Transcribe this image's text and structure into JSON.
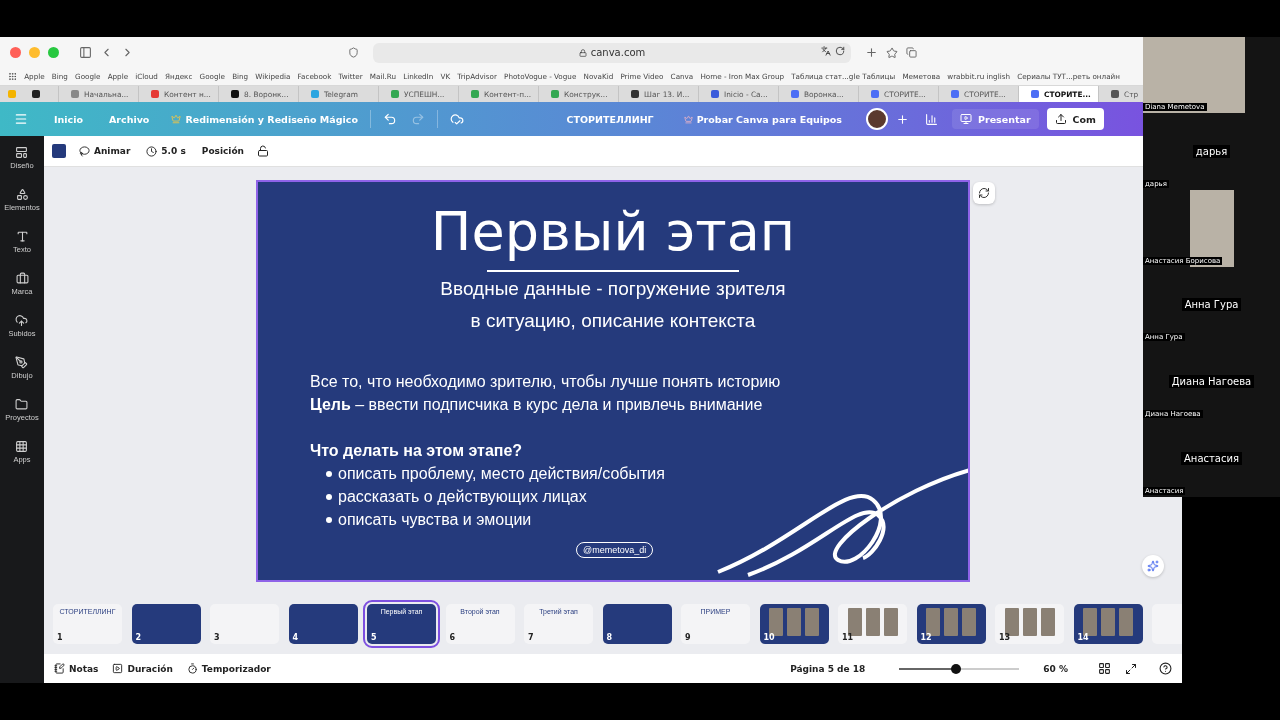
{
  "browser": {
    "url": "canva.com",
    "bookmarks": [
      "Apple",
      "Bing",
      "Google",
      "Apple",
      "iCloud",
      "Яндекс",
      "Google",
      "Bing",
      "Wikipedia",
      "Facebook",
      "Twitter",
      "Mail.Ru",
      "LinkedIn",
      "VK",
      "TripAdvisor",
      "PhotoVogue - Vogue",
      "NovaKid",
      "Prime Video",
      "Canva",
      "Home - Iron Max Group",
      "Таблица стат...gle Таблицы",
      "Меметова",
      "wrabbit.ru inglish",
      "Сериалы ТУТ...реть онлайн"
    ],
    "pinned_tabs": [
      {
        "color": "#f4b400"
      },
      {
        "color": "#222222"
      }
    ],
    "tabs": [
      {
        "title": "Начальна...",
        "color": "#888888",
        "selected": false
      },
      {
        "title": "Контент н...",
        "color": "#e53935",
        "selected": false
      },
      {
        "title": "8. Воронк...",
        "color": "#111111",
        "selected": false
      },
      {
        "title": "Telegram",
        "color": "#2ca5e0",
        "selected": false
      },
      {
        "title": "УСПЕШН...",
        "color": "#34a853",
        "selected": false
      },
      {
        "title": "Контент-п...",
        "color": "#34a853",
        "selected": false
      },
      {
        "title": "Конструк...",
        "color": "#34a853",
        "selected": false
      },
      {
        "title": "Шаг 13. И...",
        "color": "#333333",
        "selected": false
      },
      {
        "title": "Inicio - Ca...",
        "color": "#3b5bdb",
        "selected": false
      },
      {
        "title": "Воронка...",
        "color": "#4c6ef5",
        "selected": false
      },
      {
        "title": "СТОРИТЕ...",
        "color": "#4c6ef5",
        "selected": false
      },
      {
        "title": "СТОРИТЕ...",
        "color": "#4c6ef5",
        "selected": false
      },
      {
        "title": "СТОРИТЕ...",
        "color": "#4c6ef5",
        "selected": true
      },
      {
        "title": "Стр",
        "color": "#555555",
        "selected": false
      }
    ]
  },
  "header": {
    "menu": [
      "Inicio",
      "Archivo"
    ],
    "magic": "Redimensión y Rediseño Mágico",
    "redo_disabled": true,
    "doc_title": "СТОРИТЕЛЛИНГ",
    "teams": "Probar Canva para Equipos",
    "present": "Presentar",
    "share": "Com"
  },
  "sidebar": [
    {
      "label": "Diseño"
    },
    {
      "label": "Elementos"
    },
    {
      "label": "Texto"
    },
    {
      "label": "Marca"
    },
    {
      "label": "Subidos"
    },
    {
      "label": "Dibujo"
    },
    {
      "label": "Proyectos"
    },
    {
      "label": "Apps"
    }
  ],
  "toolbar": {
    "color": "#243a7c",
    "animate": "Animar",
    "duration": "5.0 s",
    "position": "Posición"
  },
  "slide": {
    "title": "Первый этап",
    "subtitle": [
      "Вводные данные - погружение зрителя",
      "в ситуацию, описание контекста"
    ],
    "body": [
      "Все то, что необходимо зрителю, чтобы лучше понять историю",
      "**Цель** – ввести подписчика в курс дела и привлечь внимание"
    ],
    "question": "Что делать на этом этапе?",
    "bullets": [
      "описать проблему, место действия/события",
      "рассказать о действующих лицах",
      "описать чувства и эмоции"
    ],
    "handle": "@memetova_di"
  },
  "thumbnails": [
    {
      "number": "1",
      "kind": "light",
      "title": "СТОРИТЕЛЛИНГ",
      "selected": false
    },
    {
      "number": "2",
      "kind": "dark",
      "selected": false
    },
    {
      "number": "3",
      "kind": "light",
      "selected": false
    },
    {
      "number": "4",
      "kind": "dark",
      "selected": false
    },
    {
      "number": "5",
      "kind": "dark",
      "title": "Первый этап",
      "selected": true
    },
    {
      "number": "6",
      "kind": "light",
      "title": "Второй этап",
      "selected": false
    },
    {
      "number": "7",
      "kind": "light",
      "title": "Третий этап",
      "selected": false
    },
    {
      "number": "8",
      "kind": "dark",
      "selected": false
    },
    {
      "number": "9",
      "kind": "light",
      "title": "ПРИМЕР",
      "selected": false
    },
    {
      "number": "10",
      "kind": "photos_dark",
      "selected": false
    },
    {
      "number": "11",
      "kind": "photos_light",
      "selected": false
    },
    {
      "number": "12",
      "kind": "photos_dark",
      "selected": false
    },
    {
      "number": "13",
      "kind": "photos_light",
      "selected": false
    },
    {
      "number": "14",
      "kind": "photos_dark",
      "selected": false
    },
    {
      "kind": "light",
      "selected": false
    }
  ],
  "footer": {
    "notes": "Notas",
    "duration": "Duración",
    "timer": "Temporizador",
    "page": "Página 5 de 18",
    "zoom": {
      "level": 0.47
    },
    "zoom_reading": "60 %"
  },
  "call": {
    "speaker": {
      "label": "Diana Memetova"
    },
    "participants": [
      {
        "kind": "name",
        "tile_name": "дарья",
        "label": "дарья"
      },
      {
        "kind": "video",
        "label": "Анастасия Борисова"
      },
      {
        "kind": "name",
        "tile_name": "Анна Гура",
        "label": "Анна Гура"
      },
      {
        "kind": "name",
        "tile_name": "Диана Нагоева",
        "label": "Диана Нагоева"
      },
      {
        "kind": "name",
        "tile_name": "Анастасия",
        "label": "Анастасия"
      }
    ]
  }
}
